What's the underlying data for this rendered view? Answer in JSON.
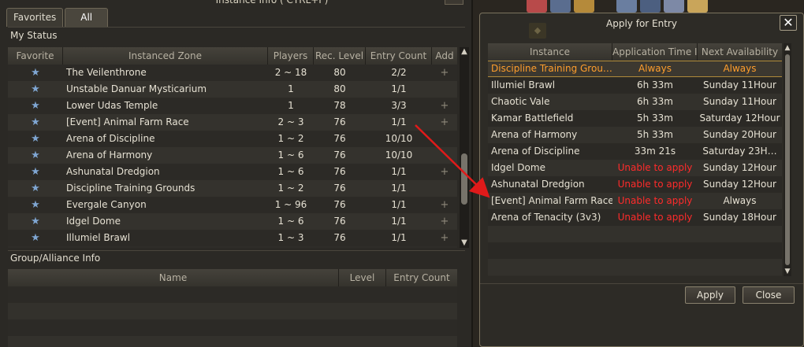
{
  "left_window": {
    "title": "Instance Info ( CTRL+I )",
    "tabs": [
      {
        "label": "Favorites",
        "active": false
      },
      {
        "label": "All",
        "active": true
      }
    ],
    "my_status_label": "My Status",
    "columns": [
      "Favorite",
      "Instanced Zone",
      "Players",
      "Rec. Level",
      "Entry Count",
      "Add"
    ],
    "rows": [
      {
        "zone": "The Veilenthrone",
        "players": "2 ~ 18",
        "level": "80",
        "entry": "2/2",
        "add": true
      },
      {
        "zone": "Unstable Danuar Mysticarium",
        "players": "1",
        "level": "80",
        "entry": "1/1",
        "add": false
      },
      {
        "zone": "Lower Udas Temple",
        "players": "1",
        "level": "78",
        "entry": "3/3",
        "add": true
      },
      {
        "zone": "[Event] Animal Farm Race",
        "players": "2 ~ 3",
        "level": "76",
        "entry": "1/1",
        "add": true
      },
      {
        "zone": "Arena of Discipline",
        "players": "1 ~ 2",
        "level": "76",
        "entry": "10/10",
        "add": false
      },
      {
        "zone": "Arena of Harmony",
        "players": "1 ~ 6",
        "level": "76",
        "entry": "10/10",
        "add": false
      },
      {
        "zone": "Ashunatal Dredgion",
        "players": "1 ~ 6",
        "level": "76",
        "entry": "1/1",
        "add": true
      },
      {
        "zone": "Discipline Training Grounds",
        "players": "1 ~ 2",
        "level": "76",
        "entry": "1/1",
        "add": false
      },
      {
        "zone": "Evergale Canyon",
        "players": "1 ~ 96",
        "level": "76",
        "entry": "1/1",
        "add": true
      },
      {
        "zone": "Idgel Dome",
        "players": "1 ~ 6",
        "level": "76",
        "entry": "1/1",
        "add": true
      },
      {
        "zone": "Illumiel Brawl",
        "players": "1 ~ 3",
        "level": "76",
        "entry": "1/1",
        "add": true
      }
    ],
    "group_label": "Group/Alliance Info",
    "group_columns": [
      "Name",
      "Level",
      "Entry Count"
    ]
  },
  "right_window": {
    "title": "Apply for Entry",
    "close_label": "✕",
    "columns": [
      "Instance",
      "Application Time I",
      "Next Availability"
    ],
    "rows": [
      {
        "instance": "Discipline Training Grou…",
        "time": "Always",
        "next": "Always",
        "selected": true,
        "unable": false
      },
      {
        "instance": "Illumiel Brawl",
        "time": "6h 33m",
        "next": "Sunday 11Hour",
        "selected": false,
        "unable": false
      },
      {
        "instance": "Chaotic Vale",
        "time": "6h 33m",
        "next": "Sunday 11Hour",
        "selected": false,
        "unable": false
      },
      {
        "instance": "Kamar Battlefield",
        "time": "5h 33m",
        "next": "Saturday 12Hour",
        "selected": false,
        "unable": false
      },
      {
        "instance": "Arena of Harmony",
        "time": "5h 33m",
        "next": "Sunday 20Hour",
        "selected": false,
        "unable": false
      },
      {
        "instance": "Arena of Discipline",
        "time": "33m 21s",
        "next": "Saturday 23H…",
        "selected": false,
        "unable": false
      },
      {
        "instance": "Idgel Dome",
        "time": "Unable to apply",
        "next": "Sunday 12Hour",
        "selected": false,
        "unable": true
      },
      {
        "instance": "Ashunatal Dredgion",
        "time": "Unable to apply",
        "next": "Sunday 12Hour",
        "selected": false,
        "unable": true
      },
      {
        "instance": "[Event] Animal Farm Race",
        "time": "Unable to apply",
        "next": "Always",
        "selected": false,
        "unable": true
      },
      {
        "instance": "Arena of Tenacity (3v3)",
        "time": "Unable to apply",
        "next": "Sunday 18Hour",
        "selected": false,
        "unable": true
      }
    ],
    "apply_label": "Apply",
    "close_button_label": "Close"
  },
  "colors": {
    "selected_text": "#ff9e2c",
    "unable_text": "#ff2b2b",
    "star": "#7fa6d2",
    "arrow": "#e01a1a"
  }
}
